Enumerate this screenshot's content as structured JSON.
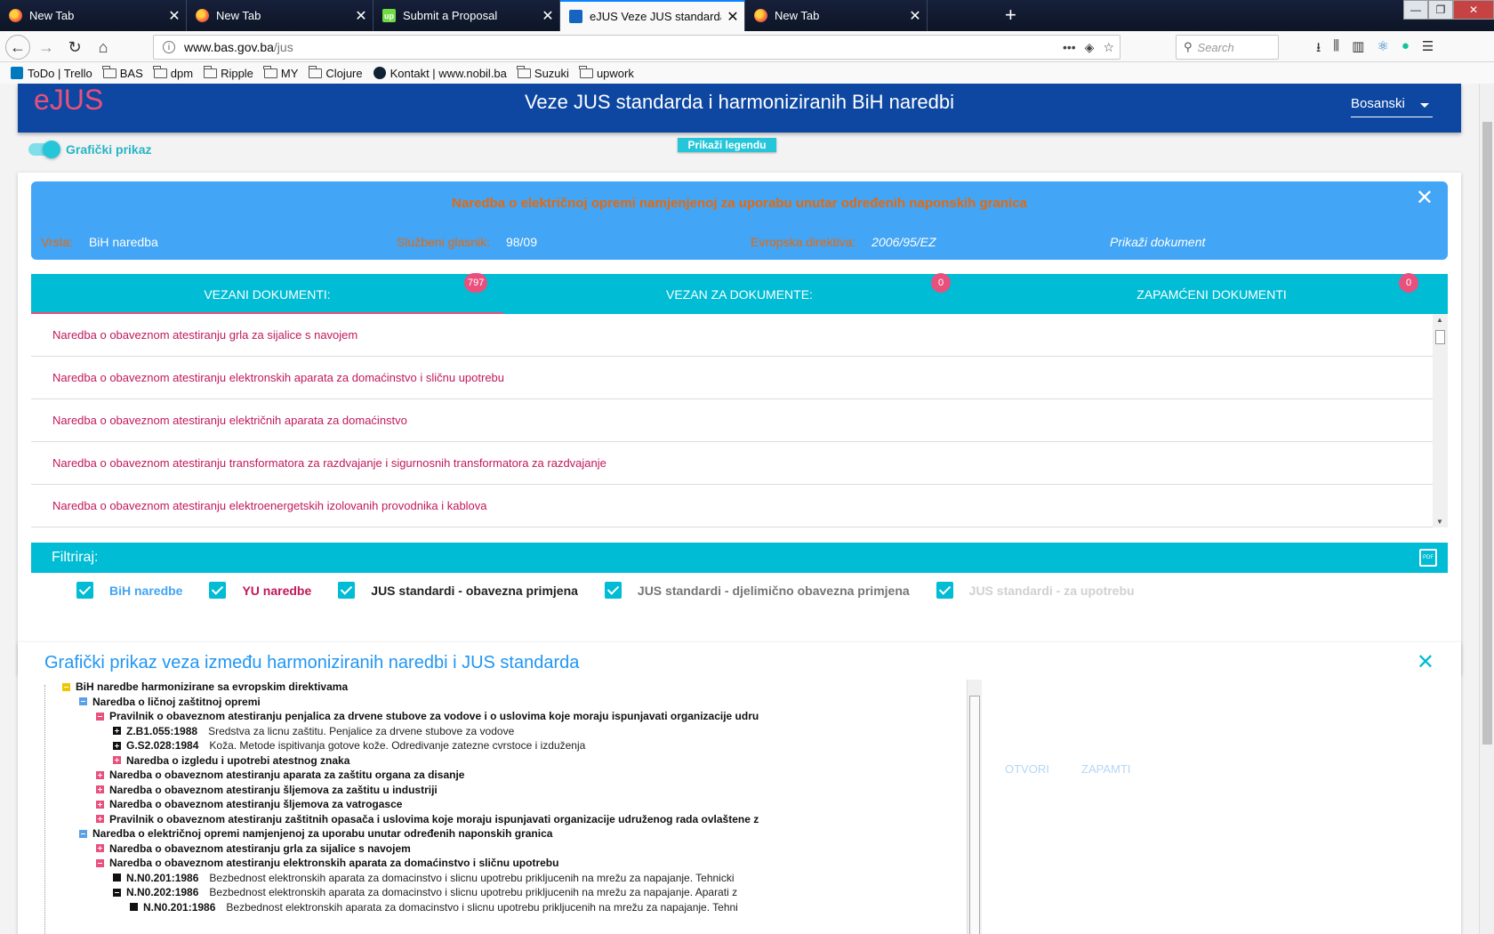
{
  "browser": {
    "tabs": [
      {
        "title": "New Tab",
        "icon": "firefox-icon",
        "active": false
      },
      {
        "title": "New Tab",
        "icon": "firefox-icon",
        "active": false
      },
      {
        "title": "Submit a Proposal",
        "icon": "upwork-icon",
        "active": false
      },
      {
        "title": "eJUS Veze JUS standarda i harmoniz",
        "icon": "bas-icon",
        "active": true
      },
      {
        "title": "New Tab",
        "icon": "firefox-icon",
        "active": false
      }
    ],
    "url_host": "www.bas.gov.ba",
    "url_path": "/jus",
    "search_placeholder": "Search",
    "bookmarks": [
      "ToDo | Trello",
      "BAS",
      "dpm",
      "Ripple",
      "MY",
      "Clojure",
      "Kontakt | www.nobil.ba",
      "Suzuki",
      "upwork"
    ]
  },
  "header": {
    "logo": "eJUS",
    "title": "Veze JUS standarda i harmoniziranih BiH naredbi",
    "language": "Bosanski"
  },
  "toggle_label": "Grafički prikaz",
  "legend_button": "Prikaži legendu",
  "info": {
    "title": "Naredba o električnoj opremi namjenjenoj za uporabu unutar određenih naponskih granica",
    "vrsta_label": "Vrsta:",
    "vrsta_value": "BiH naredba",
    "glasnik_label": "Službeni glasnik:",
    "glasnik_value": "98/09",
    "direktiva_label": "Evropska direktiva:",
    "direktiva_value": "2006/95/EZ",
    "doc_link": "Prikaži dokument"
  },
  "tabs": [
    {
      "label": "VEZANI DOKUMENTI:",
      "count": "797"
    },
    {
      "label": "VEZAN ZA DOKUMENTE:",
      "count": "0"
    },
    {
      "label": "ZAPAMĆENI DOKUMENTI",
      "count": "0"
    }
  ],
  "documents": [
    "Naredba o obaveznom atestiranju grla za sijalice s navojem",
    "Naredba o obaveznom atestiranju elektronskih aparata za domaćinstvo i sličnu upotrebu",
    "Naredba o obaveznom atestiranju električnih aparata za domaćinstvo",
    "Naredba o obaveznom atestiranju transformatora za razdvajanje i sigurnosnih transformatora za razdvajanje",
    "Naredba o obaveznom atestiranju elektroenergetskih izolovanih provodnika i kablova"
  ],
  "filter": {
    "label": "Filtriraj:",
    "options": [
      {
        "label": "BiH naredbe",
        "color": "#42a5f5"
      },
      {
        "label": "YU naredbe",
        "color": "#c2185b"
      },
      {
        "label": "JUS standardi - obavezna primjena",
        "color": "#222222"
      },
      {
        "label": "JUS standardi - djelimično obavezna primjena",
        "color": "#757575"
      },
      {
        "label": "JUS standardi - za upotrebu",
        "color": "#d0d0d0"
      }
    ]
  },
  "graph": {
    "title": "Grafički prikaz veza između harmoniziranih naredbi i JUS standarda",
    "open_button": "OTVORI",
    "save_button": "ZAPAMTI",
    "tree": [
      {
        "indent": 0,
        "icon": "yellow",
        "code": "",
        "text": "BiH naredbe harmonizirane sa evropskim direktivama",
        "bold": true
      },
      {
        "indent": 1,
        "icon": "blue",
        "code": "",
        "text": "Naredba o ličnoj zaštitnoj opremi",
        "bold": true
      },
      {
        "indent": 2,
        "icon": "pink",
        "code": "",
        "text": "Pravilnik o obaveznom atestiranju penjalica za drvene stubove za vodove i o uslovima koje moraju ispunjavati organizacije udru",
        "bold": true
      },
      {
        "indent": 3,
        "icon": "black-plus",
        "code": "Z.B1.055:1988",
        "text": "Sredstva za licnu zaštitu. Penjalice za drvene stubove za vodove",
        "bold": false
      },
      {
        "indent": 3,
        "icon": "black-plus",
        "code": "G.S2.028:1984",
        "text": "Koža. Metode ispitivanja gotove kože. Odredivanje zatezne cvrstoce i izduženja",
        "bold": false
      },
      {
        "indent": 3,
        "icon": "pink-plus",
        "code": "",
        "text": "Naredba o izgledu i upotrebi atestnog znaka",
        "bold": true
      },
      {
        "indent": 2,
        "icon": "pink-plus",
        "code": "",
        "text": "Naredba o obaveznom atestiranju aparata za zaštitu organa za disanje",
        "bold": true
      },
      {
        "indent": 2,
        "icon": "pink-plus",
        "code": "",
        "text": "Naredba o obaveznom atestiranju šljemova za zaštitu u industriji",
        "bold": true
      },
      {
        "indent": 2,
        "icon": "pink-plus",
        "code": "",
        "text": "Naredba o obaveznom atestiranju šljemova za vatrogasce",
        "bold": true
      },
      {
        "indent": 2,
        "icon": "pink-plus",
        "code": "",
        "text": "Pravilnik o obaveznom atestiranju zaštitnih opasača i uslovima koje moraju ispunjavati organizacije udruženog rada ovlaštene z",
        "bold": true
      },
      {
        "indent": 1,
        "icon": "blue",
        "code": "",
        "text": "Naredba o električnoj opremi namjenjenoj za uporabu unutar određenih naponskih granica",
        "bold": true
      },
      {
        "indent": 2,
        "icon": "pink-plus",
        "code": "",
        "text": "Naredba o obaveznom atestiranju grla za sijalice s navojem",
        "bold": true
      },
      {
        "indent": 2,
        "icon": "pink",
        "code": "",
        "text": "Naredba o obaveznom atestiranju elektronskih aparata za domaćinstvo i sličnu upotrebu",
        "bold": true
      },
      {
        "indent": 3,
        "icon": "black-sq",
        "code": "N.N0.201:1986",
        "text": "Bezbednost elektronskih aparata za domacinstvo i slicnu upotrebu prikljucenih na mrežu za napajanje. Tehnicki",
        "bold": false
      },
      {
        "indent": 3,
        "icon": "black",
        "code": "N.N0.202:1986",
        "text": "Bezbednost elektronskih aparata za domacinstvo i slicnu upotrebu prikljucenih na mrežu za napajanje. Aparati z",
        "bold": false
      },
      {
        "indent": 4,
        "icon": "black-sq",
        "code": "N.N0.201:1986",
        "text": "Bezbednost elektronskih aparata za domacinstvo i slicnu upotrebu prikljucenih na mrežu za napajanje. Tehni",
        "bold": false
      }
    ]
  }
}
